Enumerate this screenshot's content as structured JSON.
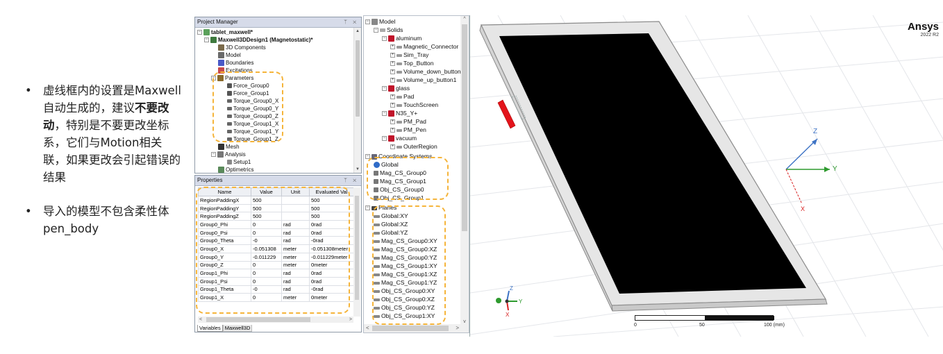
{
  "notes": {
    "n1_a": "虚线框内的设置是Maxwell自动生成的，建议",
    "n1_b": "不要改动",
    "n1_c": "，特别是不要更改坐标系，它们与Motion相关联，如果更改会引起错误的结果",
    "n2": "导入的模型不包含柔性体pen_body"
  },
  "project_manager": {
    "title": "Project Manager",
    "title_btns": "ᛘ ✕",
    "items": {
      "project": "tablet_maxwell*",
      "design": "Maxwell3DDesign1 (Magnetostatic)*",
      "components": "3D Components",
      "model": "Model",
      "boundaries": "Boundaries",
      "excitations": "Excitations",
      "parameters": "Parameters",
      "mesh": "Mesh",
      "analysis": "Analysis",
      "setup": "Setup1",
      "optimetrics": "Optimetrics"
    },
    "parameters": [
      "Force_Group0",
      "Force_Group1",
      "Torque_Group0_X",
      "Torque_Group0_Y",
      "Torque_Group0_Z",
      "Torque_Group1_X",
      "Torque_Group1_Y",
      "Torque_Group1_Z"
    ]
  },
  "properties": {
    "title": "Properties",
    "title_btns": "ᛘ ✕",
    "headers": [
      "Name",
      "Value",
      "Unit",
      "Evaluated Val"
    ],
    "rows": [
      [
        "RegionPaddingX",
        "500",
        "",
        "500"
      ],
      [
        "RegionPaddingY",
        "500",
        "",
        "500"
      ],
      [
        "RegionPaddingZ",
        "500",
        "",
        "500"
      ],
      [
        "Group0_Phi",
        "0",
        "rad",
        "0rad"
      ],
      [
        "Group0_Psi",
        "0",
        "rad",
        "0rad"
      ],
      [
        "Group0_Theta",
        "-0",
        "rad",
        "-0rad"
      ],
      [
        "Group0_X",
        "-0.051308",
        "meter",
        "-0.051308meter"
      ],
      [
        "Group0_Y",
        "-0.011229",
        "meter",
        "-0.011229meter"
      ],
      [
        "Group0_Z",
        "0",
        "meter",
        "0meter"
      ],
      [
        "Group1_Phi",
        "0",
        "rad",
        "0rad"
      ],
      [
        "Group1_Psi",
        "0",
        "rad",
        "0rad"
      ],
      [
        "Group1_Theta",
        "-0",
        "rad",
        "-0rad"
      ],
      [
        "Group1_X",
        "0",
        "meter",
        "0meter"
      ]
    ],
    "tabs": [
      "Variables",
      "Maxwell3D"
    ]
  },
  "model_tree": {
    "model": "Model",
    "solids": "Solids",
    "aluminum": "aluminum",
    "aluminum_items": [
      "Magnetic_Connector",
      "Sim_Tray",
      "Top_Button",
      "Volume_down_button",
      "Volume_up_button1"
    ],
    "glass": "glass",
    "glass_items": [
      "Pad",
      "TouchScreen"
    ],
    "n35": "N35_Y+",
    "n35_items": [
      "PM_Pad",
      "PM_Pen"
    ],
    "vacuum": "vacuum",
    "vacuum_items": [
      "OuterRegion"
    ],
    "coord": "Coordinate Systems",
    "coord_items": [
      "Global",
      "Mag_CS_Group0",
      "Mag_CS_Group1",
      "Obj_CS_Group0",
      "Obj_CS_Group1"
    ],
    "planes": "Planes",
    "plane_items": [
      "Global:XY",
      "Global:XZ",
      "Global:YZ",
      "Mag_CS_Group0:XY",
      "Mag_CS_Group0:XZ",
      "Mag_CS_Group0:YZ",
      "Mag_CS_Group1:XY",
      "Mag_CS_Group1:XZ",
      "Mag_CS_Group1:YZ",
      "Obj_CS_Group0:XY",
      "Obj_CS_Group0:XZ",
      "Obj_CS_Group0:YZ",
      "Obj_CS_Group1:XY"
    ]
  },
  "viewport": {
    "brand": "Ansys",
    "version": "2022 R2",
    "axis_z": "Z",
    "axis_y": "Y",
    "axis_x": "X",
    "tri_z": "Z",
    "tri_y": "Y",
    "tri_x": "X",
    "scale_0": "0",
    "scale_50": "50",
    "scale_100": "100 (mm)"
  }
}
